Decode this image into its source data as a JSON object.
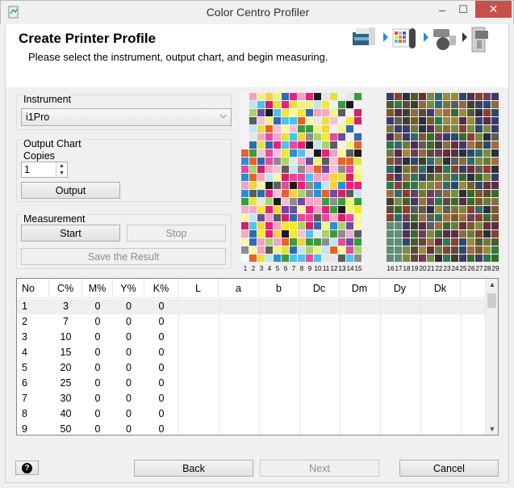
{
  "window": {
    "title": "Color Centro Profiler",
    "minimize": "–",
    "maximize": "☐",
    "close": "✕"
  },
  "header": {
    "title": "Create Printer Profile",
    "subtitle": "Please select the instrument, output chart, and begin measuring."
  },
  "instrument": {
    "label": "Instrument",
    "value": "i1Pro"
  },
  "output_chart": {
    "label": "Output Chart",
    "copies_label": "Copies",
    "copies_value": "1",
    "output_button": "Output"
  },
  "measurement": {
    "label": "Measurement",
    "start_button": "Start",
    "stop_button": "Stop",
    "save_button": "Save the Result"
  },
  "chart_labels": [
    "1",
    "2",
    "3",
    "4",
    "5",
    "6",
    "7",
    "8",
    "9",
    "10",
    "11",
    "12",
    "13",
    "14",
    "15",
    "16",
    "17",
    "18",
    "19",
    "20",
    "21",
    "22",
    "23",
    "24",
    "25",
    "26",
    "27",
    "28",
    "29"
  ],
  "table": {
    "headers": [
      "No",
      "C%",
      "M%",
      "Y%",
      "K%",
      "L",
      "a",
      "b",
      "Dc",
      "Dm",
      "Dy",
      "Dk"
    ],
    "rows": [
      [
        "1",
        "3",
        "0",
        "0",
        "0"
      ],
      [
        "2",
        "7",
        "0",
        "0",
        "0"
      ],
      [
        "3",
        "10",
        "0",
        "0",
        "0"
      ],
      [
        "4",
        "15",
        "0",
        "0",
        "0"
      ],
      [
        "5",
        "20",
        "0",
        "0",
        "0"
      ],
      [
        "6",
        "25",
        "0",
        "0",
        "0"
      ],
      [
        "7",
        "30",
        "0",
        "0",
        "0"
      ],
      [
        "8",
        "40",
        "0",
        "0",
        "0"
      ],
      [
        "9",
        "50",
        "0",
        "0",
        "0"
      ]
    ]
  },
  "footer": {
    "help": "?",
    "back": "Back",
    "next": "Next",
    "cancel": "Cancel"
  },
  "colors": {
    "close_button": "#c7504a",
    "accent_arrow": "#1f8fe0"
  }
}
